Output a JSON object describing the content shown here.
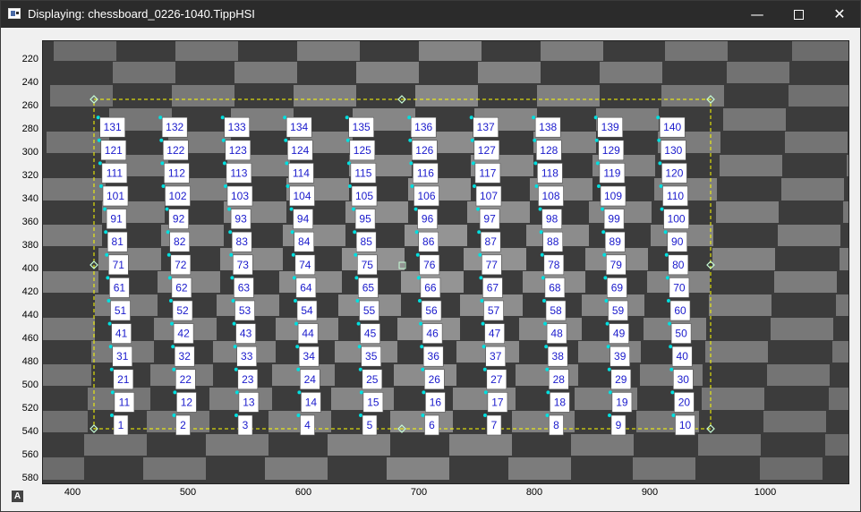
{
  "window": {
    "title": "Displaying: chessboard_0226-1040.TippHSI",
    "app_icon": "image-window-icon",
    "controls": {
      "minimize": "—",
      "maximize_icon": "square-icon",
      "close": "✕"
    }
  },
  "plot": {
    "x_ticks": [
      "400",
      "500",
      "600",
      "700",
      "800",
      "900",
      "1000"
    ],
    "y_ticks": [
      "220",
      "240",
      "260",
      "280",
      "300",
      "320",
      "340",
      "360",
      "380",
      "400",
      "420",
      "440",
      "460",
      "480",
      "500",
      "520",
      "540",
      "560",
      "580"
    ],
    "corner_icon_label": "A",
    "roi_color": "#ffff00",
    "handle_color": "#c8ffd8",
    "corner_marker_color": "#00e0e0",
    "label_text_color": "#1a1acc",
    "corner_labels": [
      "1",
      "2",
      "3",
      "4",
      "5",
      "6",
      "7",
      "8",
      "9",
      "10",
      "11",
      "12",
      "13",
      "14",
      "15",
      "16",
      "17",
      "18",
      "19",
      "20",
      "21",
      "22",
      "23",
      "24",
      "25",
      "26",
      "27",
      "28",
      "29",
      "30",
      "31",
      "32",
      "33",
      "34",
      "35",
      "36",
      "37",
      "38",
      "39",
      "40",
      "41",
      "42",
      "43",
      "44",
      "45",
      "46",
      "47",
      "48",
      "49",
      "50",
      "51",
      "52",
      "53",
      "54",
      "55",
      "56",
      "57",
      "58",
      "59",
      "60",
      "61",
      "62",
      "63",
      "64",
      "65",
      "66",
      "67",
      "68",
      "69",
      "70",
      "71",
      "72",
      "73",
      "74",
      "75",
      "76",
      "77",
      "78",
      "79",
      "80",
      "81",
      "82",
      "83",
      "84",
      "85",
      "86",
      "87",
      "88",
      "89",
      "90",
      "91",
      "92",
      "93",
      "94",
      "95",
      "96",
      "97",
      "98",
      "99",
      "100",
      "101",
      "102",
      "103",
      "104",
      "105",
      "106",
      "107",
      "108",
      "109",
      "110",
      "111",
      "112",
      "113",
      "114",
      "115",
      "116",
      "117",
      "118",
      "119",
      "120",
      "121",
      "122",
      "123",
      "124",
      "125",
      "126",
      "127",
      "128",
      "129",
      "130",
      "131",
      "132",
      "133",
      "134",
      "135",
      "136",
      "137",
      "138",
      "139",
      "140"
    ]
  }
}
